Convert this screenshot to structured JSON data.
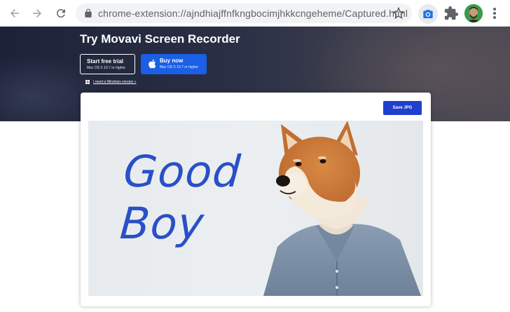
{
  "browser": {
    "url": "chrome-extension://ajndhiajffnfkngbocimjhkkcngeheme/Captured.html",
    "icons": {
      "back": "arrow-back-icon",
      "forward": "arrow-forward-icon",
      "reload": "reload-icon",
      "lock": "lock-icon",
      "bookmark": "star-icon",
      "extension_capture": "camera-icon",
      "extensions": "puzzle-icon",
      "profile": "avatar",
      "menu": "more-vert-icon"
    }
  },
  "hero": {
    "title": "Try Movavi Screen Recorder",
    "trial_button": {
      "label": "Start free trial",
      "sublabel": "Mac OS X 10.7 or higher"
    },
    "buy_button": {
      "label": "Buy now",
      "sublabel": "Mac OS X 10.7 or higher"
    },
    "windows_link": "I need a Windows version »"
  },
  "card": {
    "save_button": "Save JPG",
    "caption_line1": "Good",
    "caption_line2": "Boy"
  },
  "colors": {
    "accent": "#1a5fe6",
    "save": "#1f3fce",
    "caption": "#2950c8"
  }
}
